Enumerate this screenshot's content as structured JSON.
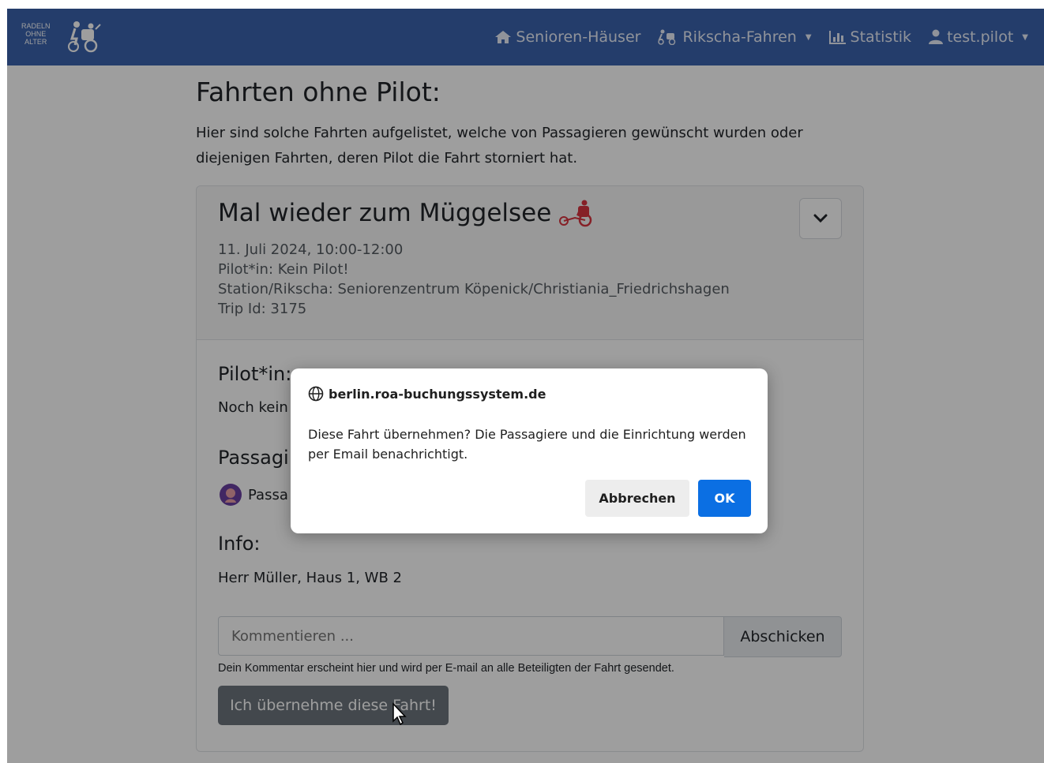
{
  "brand": {
    "lines": [
      "RADELN",
      "OHNE",
      "ALTER"
    ]
  },
  "nav": {
    "items": [
      {
        "label": "Senioren-Häuser",
        "icon": "home-icon"
      },
      {
        "label": "Rikscha-Fahren",
        "icon": "rickshaw-icon",
        "dropdown": true
      },
      {
        "label": "Statistik",
        "icon": "bar-chart-icon"
      },
      {
        "label": "test.pilot",
        "icon": "user-icon",
        "dropdown": true
      }
    ]
  },
  "page": {
    "title": "Fahrten ohne Pilot:",
    "intro": "Hier sind solche Fahrten aufgelistet, welche von Passagieren gewünscht wurden oder diejenigen Fahrten, deren Pilot die Fahrt storniert hat."
  },
  "trip": {
    "title": "Mal wieder zum Müggelsee",
    "date": "11. Juli 2024, 10:00-12:00",
    "pilot": "Pilot*in: Kein Pilot!",
    "station": "Station/Rikscha: Seniorenzentrum Köpenick/Christiania_Friedrichshagen",
    "trip_id": "Trip Id: 3175",
    "pilot_heading": "Pilot*in:",
    "pilot_text": "Noch kein",
    "passenger_heading": "Passagi",
    "passenger_text": "Passa",
    "info_heading": "Info:",
    "info_text": "Herr Müller, Haus 1, WB 2",
    "comment_placeholder": "Kommentieren ...",
    "comment_button": "Abschicken",
    "comment_hint": "Dein Kommentar erscheint hier und wird per E-mail an alle Beteiligten der Fahrt gesendet.",
    "take_button": "Ich übernehme diese Fahrt!"
  },
  "dialog": {
    "origin": "berlin.roa-buchungssystem.de",
    "message": "Diese Fahrt übernehmen? Die Passagiere und die Einrichtung werden per Email benachrichtigt.",
    "cancel": "Abbrechen",
    "ok": "OK"
  },
  "colors": {
    "navbar": "#3b63ad",
    "accent_red": "#d9343f",
    "ok_button": "#0b6fe3",
    "take_button": "#6c757d"
  }
}
